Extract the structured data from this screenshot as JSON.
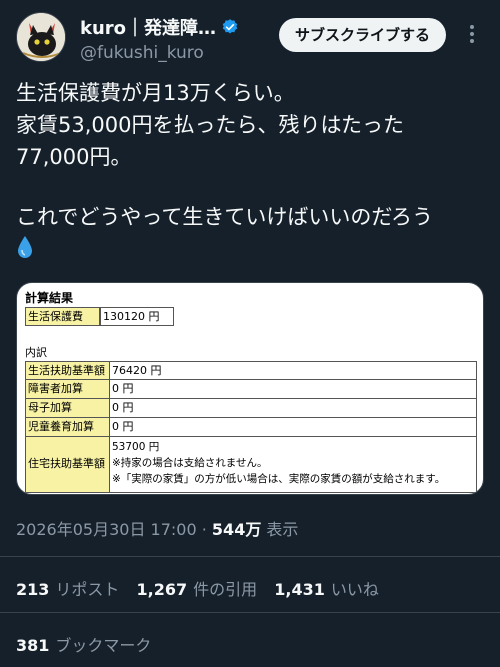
{
  "author": {
    "display_name": "kuro｜発達障…",
    "handle": "@fukushi_kuro",
    "verified_icon": "verified-badge-icon",
    "avatar_icon": "cat-avatar"
  },
  "subscribe_label": "サブスクライブする",
  "more_icon": "more-icon",
  "tweet": {
    "lines": [
      "生活保護費が月13万くらい。",
      "家賃53,000円を払ったら、残りはたった",
      "77,000円。",
      "これでどうやって生きていけばいいのだろう"
    ],
    "emoji": "droplet-icon"
  },
  "card": {
    "title": "計算結果",
    "summary": {
      "label": "生活保護費",
      "value": "130120 円"
    },
    "breakdown_title": "内訳",
    "rows": [
      {
        "label": "生活扶助基準額",
        "value": "76420 円"
      },
      {
        "label": "障害者加算",
        "value": "0 円"
      },
      {
        "label": "母子加算",
        "value": "0 円"
      },
      {
        "label": "児童養育加算",
        "value": "0 円"
      }
    ],
    "housing": {
      "label": "住宅扶助基準額",
      "value": "53700 円",
      "note1": "※持家の場合は支給されません。",
      "note2": "※「実際の家賃」の方が低い場合は、実際の家賃の額が支給されます。"
    }
  },
  "meta": {
    "timestamp": "2026年05月30日 17:00",
    "separator": "·",
    "views_count": "544万",
    "views_label": "表示"
  },
  "stats": {
    "reposts_count": "213",
    "reposts_label": "リポスト",
    "quotes_count": "1,267",
    "quotes_label": "件の引用",
    "likes_count": "1,431",
    "likes_label": "いいね",
    "bookmarks_count": "381",
    "bookmarks_label": "ブックマーク"
  },
  "colors": {
    "background": "#15202b",
    "verified": "#1d9bf0",
    "muted": "#8b98a5",
    "divider": "#38444d"
  }
}
